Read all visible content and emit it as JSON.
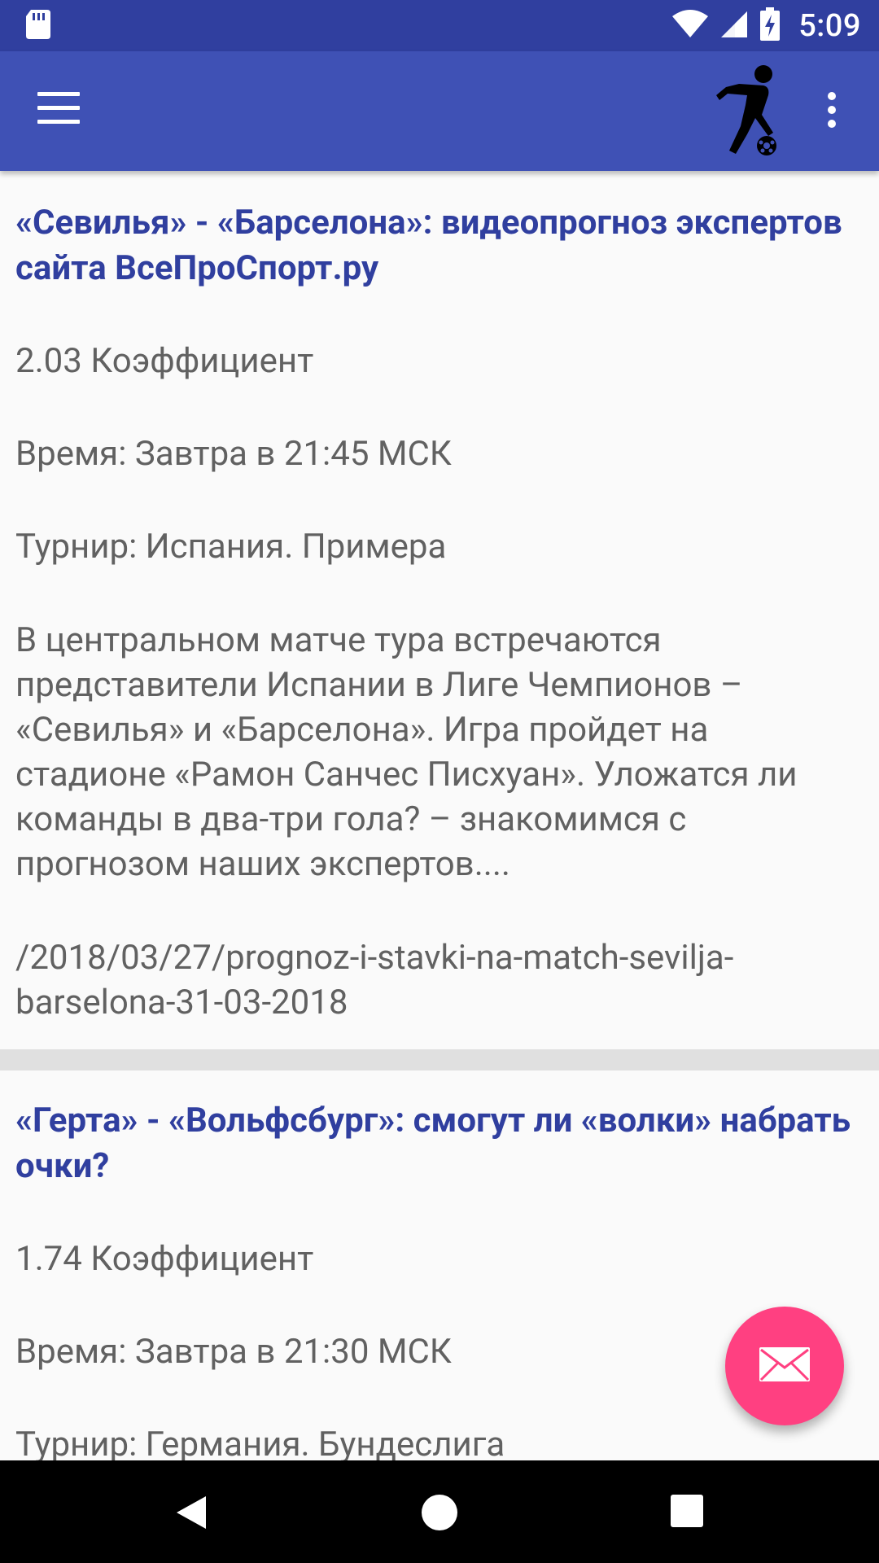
{
  "status_bar": {
    "time": "5:09",
    "icons": [
      "sd-card-icon",
      "wifi-icon",
      "cell-signal-icon",
      "battery-charging-icon"
    ]
  },
  "app_bar": {
    "menu_icon": "hamburger-menu-icon",
    "logo_icon": "soccer-player-icon",
    "overflow_icon": "more-vert-icon",
    "color": "#3f51b5"
  },
  "articles": [
    {
      "title": "«Севилья» - «Барселона»: видеопрогноз экспертов сайта ВсеПроСпорт.ру",
      "coefficient": "2.03 Коэффициент",
      "time": "Время: Завтра в 21:45 МСК",
      "tournament": "Турнир: Испания. Примера",
      "description": "В центральном матче тура встречаются представители Испании в Лиге Чемпионов – «Севилья» и «Барселона». Игра пройдет на стадионе «Рамон Санчес Писхуан». Уложатся ли команды в два-три гола? – знакомимся с прогнозом наших экспертов....",
      "link": "/2018/03/27/prognoz-i-stavki-na-match-sevilja-barselona-31-03-2018"
    },
    {
      "title": "«Герта» - «Вольфсбург»: смогут ли «волки» набрать очки?",
      "coefficient": "1.74 Коэффициент",
      "time": "Время: Завтра в 21:30 МСК",
      "tournament": "Турнир: Германия. Бундеслига"
    }
  ],
  "fab": {
    "icon": "mail-icon",
    "color": "#ff4081"
  },
  "nav_bar": {
    "icons": [
      "back-icon",
      "home-icon",
      "recents-icon"
    ]
  },
  "colors": {
    "status_bar": "#303f9f",
    "title": "#303f9f",
    "text": "#616161"
  }
}
